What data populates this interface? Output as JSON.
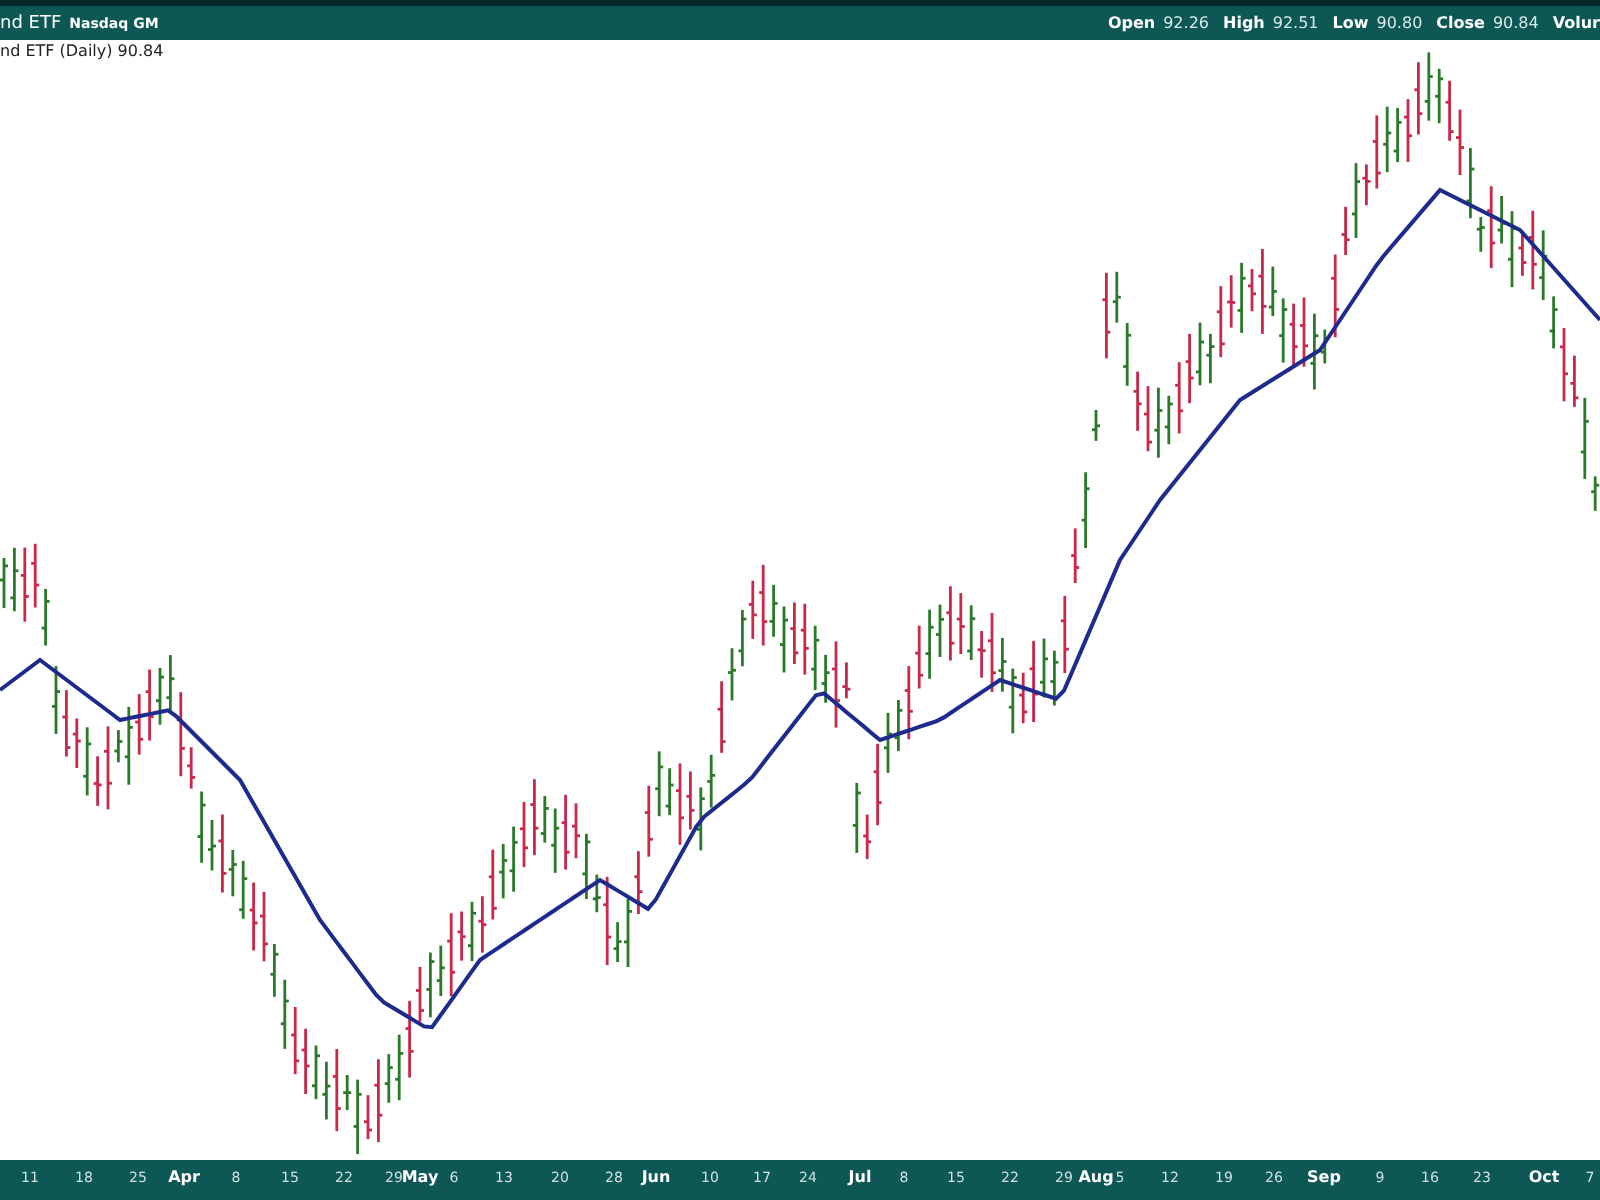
{
  "header": {
    "title": "nd ETF",
    "exchange": "Nasdaq GM",
    "quote": [
      {
        "label": "Open",
        "value": "92.26"
      },
      {
        "label": "High",
        "value": "92.51"
      },
      {
        "label": "Low",
        "value": "90.80"
      },
      {
        "label": "Close",
        "value": "90.84"
      },
      {
        "label": "Volur"
      }
    ]
  },
  "legend": "nd ETF (Daily) 90.84",
  "x_axis_labels": [
    {
      "text": "11",
      "kind": "day"
    },
    {
      "text": "18",
      "kind": "day"
    },
    {
      "text": "25",
      "kind": "day"
    },
    {
      "text": "Apr",
      "kind": "month"
    },
    {
      "text": "8",
      "kind": "day"
    },
    {
      "text": "15",
      "kind": "day"
    },
    {
      "text": "22",
      "kind": "day"
    },
    {
      "text": "29",
      "kind": "day"
    },
    {
      "text": "May",
      "kind": "month"
    },
    {
      "text": "6",
      "kind": "day"
    },
    {
      "text": "13",
      "kind": "day"
    },
    {
      "text": "20",
      "kind": "day"
    },
    {
      "text": "28",
      "kind": "day"
    },
    {
      "text": "Jun",
      "kind": "month"
    },
    {
      "text": "10",
      "kind": "day"
    },
    {
      "text": "17",
      "kind": "day"
    },
    {
      "text": "24",
      "kind": "day"
    },
    {
      "text": "Jul",
      "kind": "month"
    },
    {
      "text": "8",
      "kind": "day"
    },
    {
      "text": "15",
      "kind": "day"
    },
    {
      "text": "22",
      "kind": "day"
    },
    {
      "text": "29",
      "kind": "day"
    },
    {
      "text": "Aug",
      "kind": "month"
    },
    {
      "text": "5",
      "kind": "day"
    },
    {
      "text": "12",
      "kind": "day"
    },
    {
      "text": "19",
      "kind": "day"
    },
    {
      "text": "26",
      "kind": "day"
    },
    {
      "text": "Sep",
      "kind": "month"
    },
    {
      "text": "9",
      "kind": "day"
    },
    {
      "text": "16",
      "kind": "day"
    },
    {
      "text": "23",
      "kind": "day"
    },
    {
      "text": "Oct",
      "kind": "month"
    },
    {
      "text": "7",
      "kind": "day"
    }
  ]
}
